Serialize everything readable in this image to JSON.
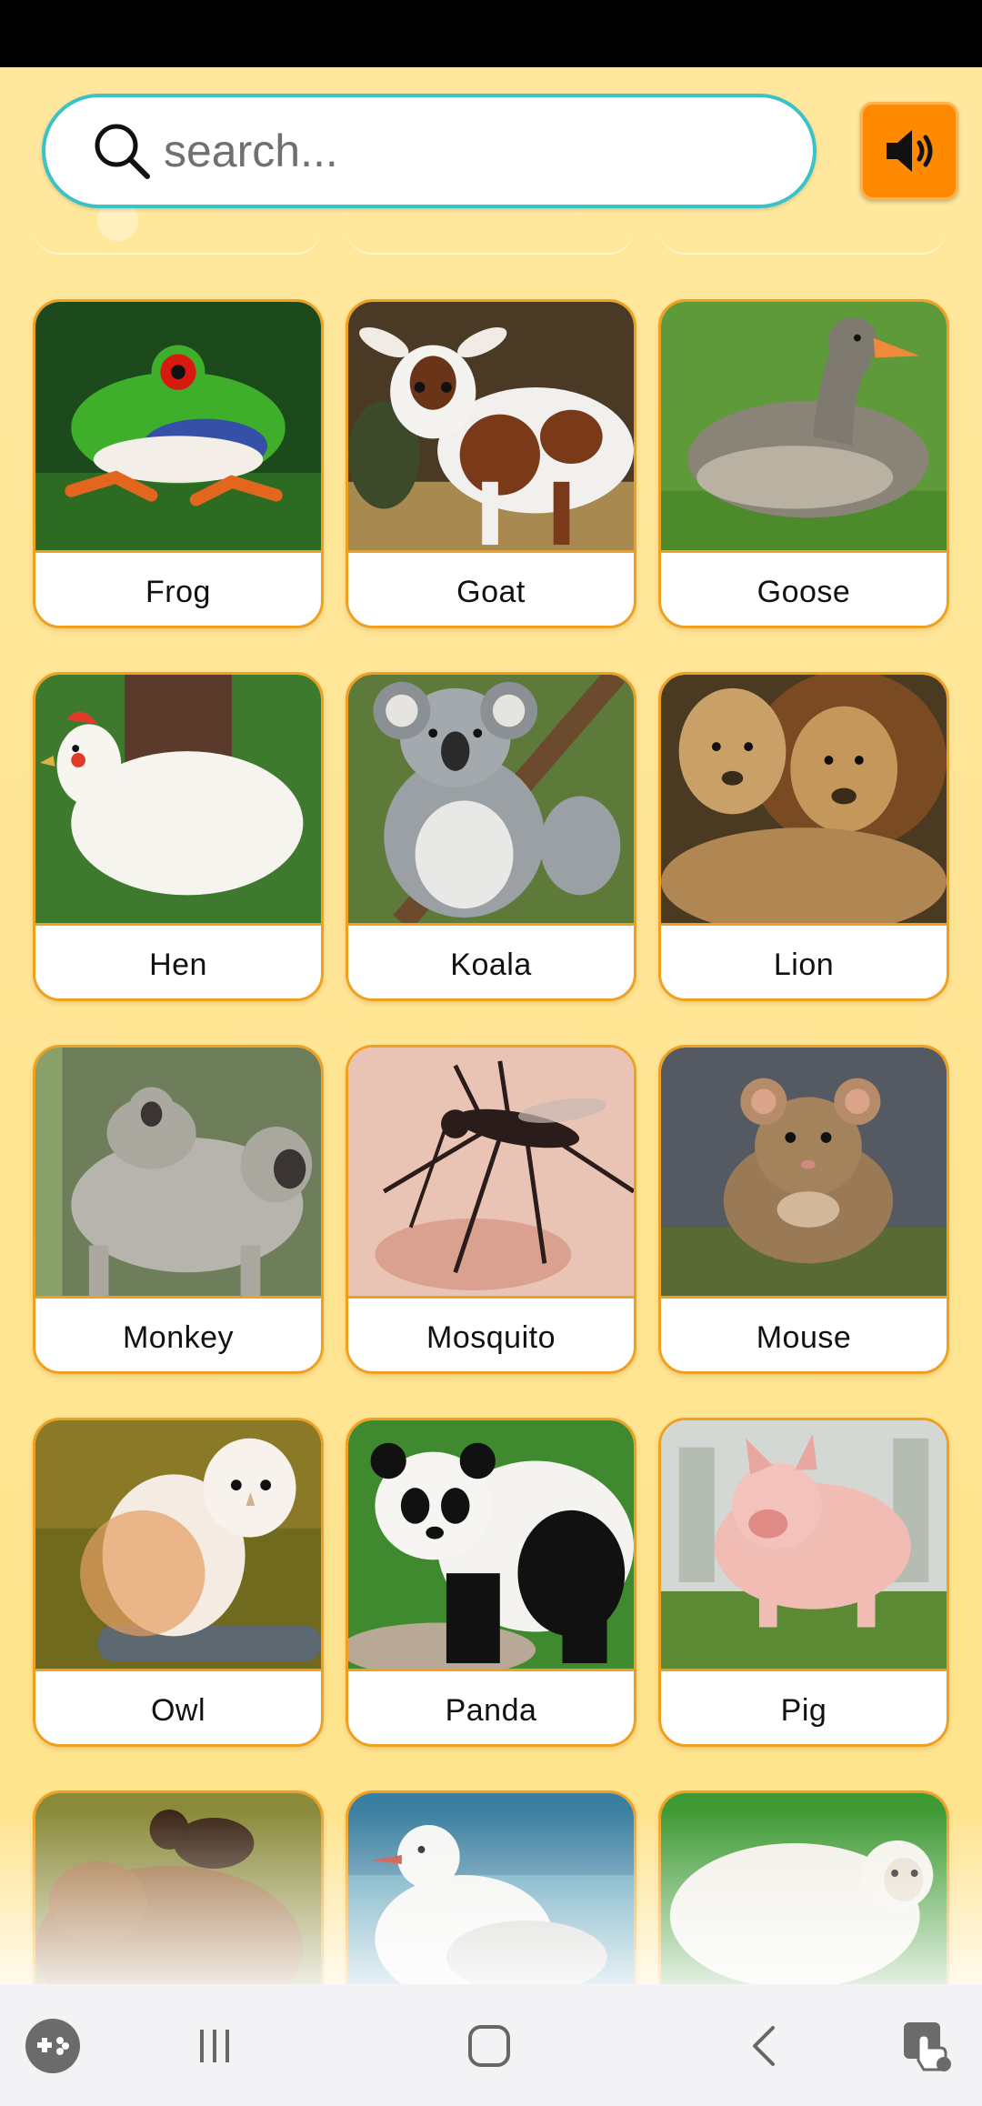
{
  "search": {
    "placeholder": "search..."
  },
  "sound_button": {
    "icon": "speaker-icon",
    "color": "#ff8a00"
  },
  "colors": {
    "background": "#ffe79a",
    "card_border": "#f0a020",
    "search_border": "#38c3c8"
  },
  "animals": [
    {
      "label": "Frog"
    },
    {
      "label": "Goat"
    },
    {
      "label": "Goose"
    },
    {
      "label": "Hen"
    },
    {
      "label": "Koala"
    },
    {
      "label": "Lion"
    },
    {
      "label": "Monkey"
    },
    {
      "label": "Mosquito"
    },
    {
      "label": "Mouse"
    },
    {
      "label": "Owl"
    },
    {
      "label": "Panda"
    },
    {
      "label": "Pig"
    }
  ],
  "partial_row": [
    "bear-photo",
    "seagull-photo",
    "sheep-photo"
  ],
  "nav": [
    "game-launcher-icon",
    "recent-apps-icon",
    "home-icon",
    "back-icon",
    "assistant-icon"
  ]
}
